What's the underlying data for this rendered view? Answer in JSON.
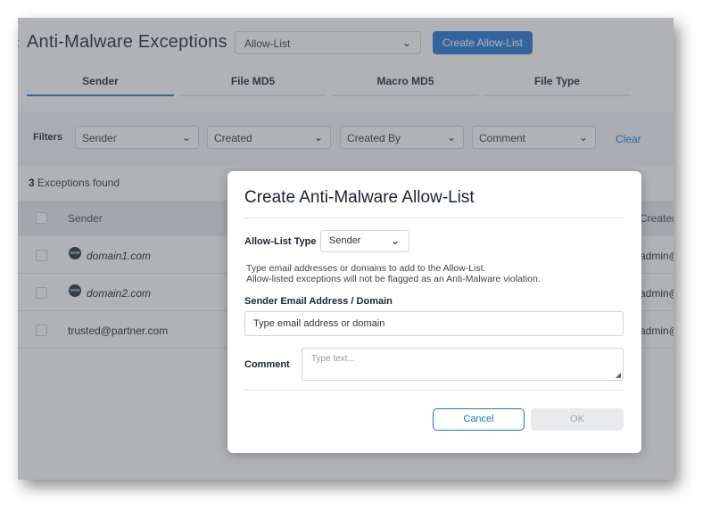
{
  "header": {
    "title": "Anti-Malware Exceptions",
    "list_type_value": "Allow-List",
    "create_button": "Create Allow-List"
  },
  "tabs": [
    {
      "label": "Sender",
      "active": true
    },
    {
      "label": "File MD5",
      "active": false
    },
    {
      "label": "Macro MD5",
      "active": false
    },
    {
      "label": "File Type",
      "active": false
    }
  ],
  "filters": {
    "label": "Filters",
    "selects": [
      "Sender",
      "Created",
      "Created By",
      "Comment"
    ],
    "clear": "Clear"
  },
  "results": {
    "count": "3",
    "count_suffix": " Exceptions found"
  },
  "table": {
    "col_sender": "Sender",
    "col_created": "Created",
    "rows": [
      {
        "sender": "domain1.com",
        "created_by": "admin@",
        "icon": "www-globe-icon"
      },
      {
        "sender": "domain2.com",
        "created_by": "admin@",
        "icon": "www-globe-icon"
      },
      {
        "sender": "trusted@partner.com",
        "created_by": "admin@",
        "icon": ""
      }
    ]
  },
  "modal": {
    "title": "Create Anti-Malware Allow-List",
    "type_label": "Allow-List Type",
    "type_value": "Sender",
    "help_line1": "Type email addresses or domains to add to the Allow-List.",
    "help_line2": "Allow-listed exceptions will not be flagged as an Anti-Malware violation.",
    "email_label": "Sender Email Address / Domain",
    "email_placeholder": "Type email address or domain",
    "comment_label": "Comment",
    "comment_placeholder": "Type text...",
    "cancel": "Cancel",
    "ok": "OK"
  },
  "icons": {
    "chevron": "⌄",
    "globe_text": "www"
  },
  "colors": {
    "accent": "#1a73d4",
    "disabled_bg": "#e8eaec"
  }
}
